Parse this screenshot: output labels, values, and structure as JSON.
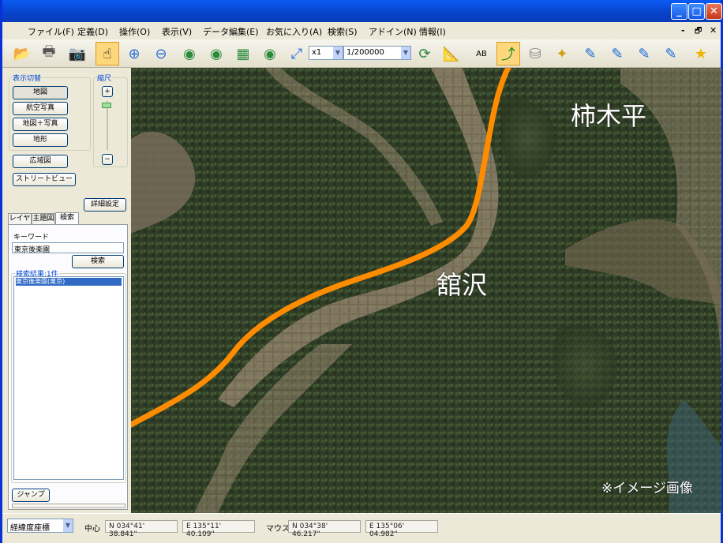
{
  "titlebar": {
    "minimize": "_",
    "maximize": "□",
    "close": "✕"
  },
  "menu": {
    "items": [
      "ファイル(F)",
      "定義(D)",
      "操作(O)",
      "表示(V)",
      "データ編集(E)",
      "お気に入り(A)",
      "検索(S)",
      "アドイン(N)",
      "情報(I)"
    ],
    "mdi_minimize": "-",
    "mdi_restore": "🗗",
    "mdi_close": "✕"
  },
  "toolbar": {
    "zoom_factor": "x1",
    "scale": "1/200000",
    "icons": [
      "folder-open-icon",
      "printer-icon",
      "camera-icon",
      "pointer-icon",
      "zoom-in-icon",
      "zoom-out-icon",
      "globe-pin-icon",
      "globe-add-icon",
      "globe-grid-icon",
      "globe-tray-icon",
      "zoom-box-icon",
      "refresh-icon",
      "ruler-icon",
      "label-icon",
      "route-icon",
      "database-icon",
      "sparkle-icon",
      "edit-1-icon",
      "edit-2-icon",
      "edit-3-icon",
      "edit-4-icon",
      "favorite-star-icon"
    ]
  },
  "left_panel": {
    "display_group_label": "表示切替",
    "scale_group_label": "縮尺",
    "btn_map": "地図",
    "btn_aerial": "航空写真",
    "btn_map_aerial": "地図＋写真",
    "btn_terrain": "地形",
    "btn_wide": "広域図",
    "btn_street": "ストリートビュー",
    "zoom_plus": "+",
    "zoom_minus": "−",
    "btn_detail": "詳細設定",
    "tabs": [
      "レイヤ",
      "主題図",
      "検索"
    ],
    "keyword_label": "キーワード",
    "keyword_value": "東京後楽園",
    "search_btn": "検索",
    "results_label": "検索結果:1件",
    "result_item": "東京後楽園(東京)",
    "jump_btn": "ジャンプ"
  },
  "map": {
    "place_1": "柿木平",
    "place_2": "舘沢",
    "note": "※イメージ画像",
    "route_color": "#ff8c00"
  },
  "statusbar": {
    "coord_system": "経緯度座標",
    "center_label": "中心",
    "center_n": "N 034°41' 38.841\"",
    "center_e": "E 135°11' 40.109\"",
    "mouse_label": "マウス",
    "mouse_n": "N 034°38' 46.217\"",
    "mouse_e": "E 135°06' 04.982\""
  }
}
